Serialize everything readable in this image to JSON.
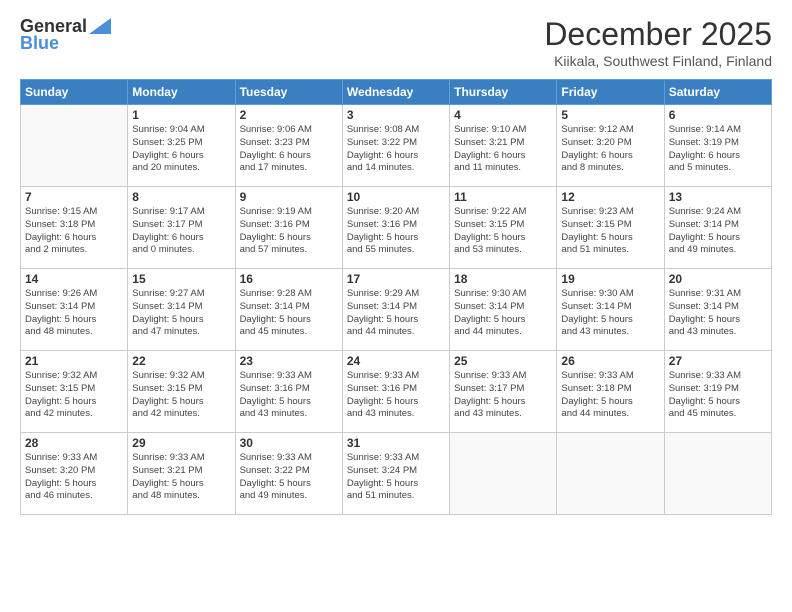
{
  "header": {
    "logo_general": "General",
    "logo_blue": "Blue",
    "title": "December 2025",
    "location": "Kiikala, Southwest Finland, Finland"
  },
  "days_of_week": [
    "Sunday",
    "Monday",
    "Tuesday",
    "Wednesday",
    "Thursday",
    "Friday",
    "Saturday"
  ],
  "weeks": [
    [
      {
        "day": "",
        "info": ""
      },
      {
        "day": "1",
        "info": "Sunrise: 9:04 AM\nSunset: 3:25 PM\nDaylight: 6 hours\nand 20 minutes."
      },
      {
        "day": "2",
        "info": "Sunrise: 9:06 AM\nSunset: 3:23 PM\nDaylight: 6 hours\nand 17 minutes."
      },
      {
        "day": "3",
        "info": "Sunrise: 9:08 AM\nSunset: 3:22 PM\nDaylight: 6 hours\nand 14 minutes."
      },
      {
        "day": "4",
        "info": "Sunrise: 9:10 AM\nSunset: 3:21 PM\nDaylight: 6 hours\nand 11 minutes."
      },
      {
        "day": "5",
        "info": "Sunrise: 9:12 AM\nSunset: 3:20 PM\nDaylight: 6 hours\nand 8 minutes."
      },
      {
        "day": "6",
        "info": "Sunrise: 9:14 AM\nSunset: 3:19 PM\nDaylight: 6 hours\nand 5 minutes."
      }
    ],
    [
      {
        "day": "7",
        "info": "Sunrise: 9:15 AM\nSunset: 3:18 PM\nDaylight: 6 hours\nand 2 minutes."
      },
      {
        "day": "8",
        "info": "Sunrise: 9:17 AM\nSunset: 3:17 PM\nDaylight: 6 hours\nand 0 minutes."
      },
      {
        "day": "9",
        "info": "Sunrise: 9:19 AM\nSunset: 3:16 PM\nDaylight: 5 hours\nand 57 minutes."
      },
      {
        "day": "10",
        "info": "Sunrise: 9:20 AM\nSunset: 3:16 PM\nDaylight: 5 hours\nand 55 minutes."
      },
      {
        "day": "11",
        "info": "Sunrise: 9:22 AM\nSunset: 3:15 PM\nDaylight: 5 hours\nand 53 minutes."
      },
      {
        "day": "12",
        "info": "Sunrise: 9:23 AM\nSunset: 3:15 PM\nDaylight: 5 hours\nand 51 minutes."
      },
      {
        "day": "13",
        "info": "Sunrise: 9:24 AM\nSunset: 3:14 PM\nDaylight: 5 hours\nand 49 minutes."
      }
    ],
    [
      {
        "day": "14",
        "info": "Sunrise: 9:26 AM\nSunset: 3:14 PM\nDaylight: 5 hours\nand 48 minutes."
      },
      {
        "day": "15",
        "info": "Sunrise: 9:27 AM\nSunset: 3:14 PM\nDaylight: 5 hours\nand 47 minutes."
      },
      {
        "day": "16",
        "info": "Sunrise: 9:28 AM\nSunset: 3:14 PM\nDaylight: 5 hours\nand 45 minutes."
      },
      {
        "day": "17",
        "info": "Sunrise: 9:29 AM\nSunset: 3:14 PM\nDaylight: 5 hours\nand 44 minutes."
      },
      {
        "day": "18",
        "info": "Sunrise: 9:30 AM\nSunset: 3:14 PM\nDaylight: 5 hours\nand 44 minutes."
      },
      {
        "day": "19",
        "info": "Sunrise: 9:30 AM\nSunset: 3:14 PM\nDaylight: 5 hours\nand 43 minutes."
      },
      {
        "day": "20",
        "info": "Sunrise: 9:31 AM\nSunset: 3:14 PM\nDaylight: 5 hours\nand 43 minutes."
      }
    ],
    [
      {
        "day": "21",
        "info": "Sunrise: 9:32 AM\nSunset: 3:15 PM\nDaylight: 5 hours\nand 42 minutes."
      },
      {
        "day": "22",
        "info": "Sunrise: 9:32 AM\nSunset: 3:15 PM\nDaylight: 5 hours\nand 42 minutes."
      },
      {
        "day": "23",
        "info": "Sunrise: 9:33 AM\nSunset: 3:16 PM\nDaylight: 5 hours\nand 43 minutes."
      },
      {
        "day": "24",
        "info": "Sunrise: 9:33 AM\nSunset: 3:16 PM\nDaylight: 5 hours\nand 43 minutes."
      },
      {
        "day": "25",
        "info": "Sunrise: 9:33 AM\nSunset: 3:17 PM\nDaylight: 5 hours\nand 43 minutes."
      },
      {
        "day": "26",
        "info": "Sunrise: 9:33 AM\nSunset: 3:18 PM\nDaylight: 5 hours\nand 44 minutes."
      },
      {
        "day": "27",
        "info": "Sunrise: 9:33 AM\nSunset: 3:19 PM\nDaylight: 5 hours\nand 45 minutes."
      }
    ],
    [
      {
        "day": "28",
        "info": "Sunrise: 9:33 AM\nSunset: 3:20 PM\nDaylight: 5 hours\nand 46 minutes."
      },
      {
        "day": "29",
        "info": "Sunrise: 9:33 AM\nSunset: 3:21 PM\nDaylight: 5 hours\nand 48 minutes."
      },
      {
        "day": "30",
        "info": "Sunrise: 9:33 AM\nSunset: 3:22 PM\nDaylight: 5 hours\nand 49 minutes."
      },
      {
        "day": "31",
        "info": "Sunrise: 9:33 AM\nSunset: 3:24 PM\nDaylight: 5 hours\nand 51 minutes."
      },
      {
        "day": "",
        "info": ""
      },
      {
        "day": "",
        "info": ""
      },
      {
        "day": "",
        "info": ""
      }
    ]
  ]
}
